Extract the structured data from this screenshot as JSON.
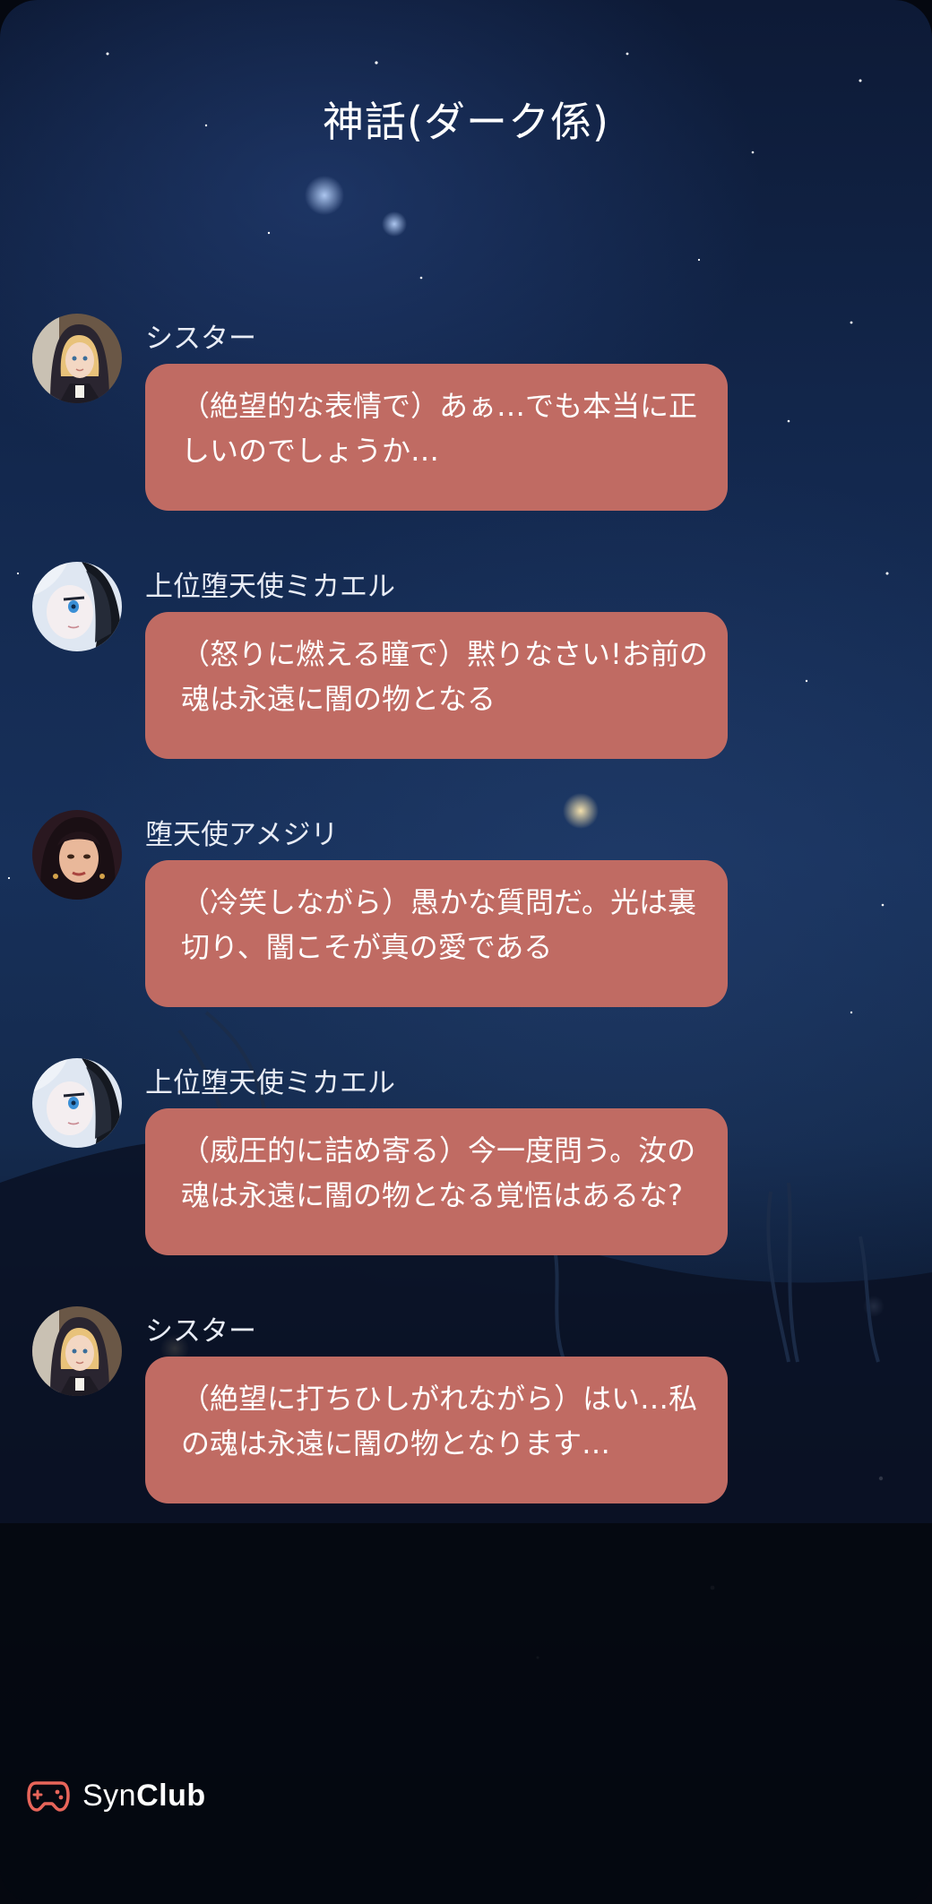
{
  "page": {
    "title": "神話(ダーク係)"
  },
  "messages": [
    {
      "sender": "シスター",
      "text": "（絶望的な表情で）あぁ…でも本当に正しいのでしょうか…",
      "avatar": "nun-avatar"
    },
    {
      "sender": "上位堕天使ミカエル",
      "text": "（怒りに燃える瞳で）黙りなさい!お前の魂は永遠に闇の物となる",
      "avatar": "michael-avatar"
    },
    {
      "sender": "堕天使アメジリ",
      "text": "（冷笑しながら）愚かな質問だ。光は裏切り、闇こそが真の愛である",
      "avatar": "amejiri-avatar"
    },
    {
      "sender": "上位堕天使ミカエル",
      "text": "（威圧的に詰め寄る）今一度問う。汝の魂は永遠に闇の物となる覚悟はあるな?",
      "avatar": "michael-avatar"
    },
    {
      "sender": "シスター",
      "text": "（絶望に打ちひしがれながら）はい…私の魂は永遠に闇の物となります…",
      "avatar": "nun-avatar"
    }
  ],
  "brand": {
    "name_light": "Syn",
    "name_bold": "Club",
    "logo_icon": "gamepad-logo-icon",
    "logo_color": "#e8655a"
  },
  "colors": {
    "bubble": "#c06b63",
    "text": "#ffffff"
  }
}
